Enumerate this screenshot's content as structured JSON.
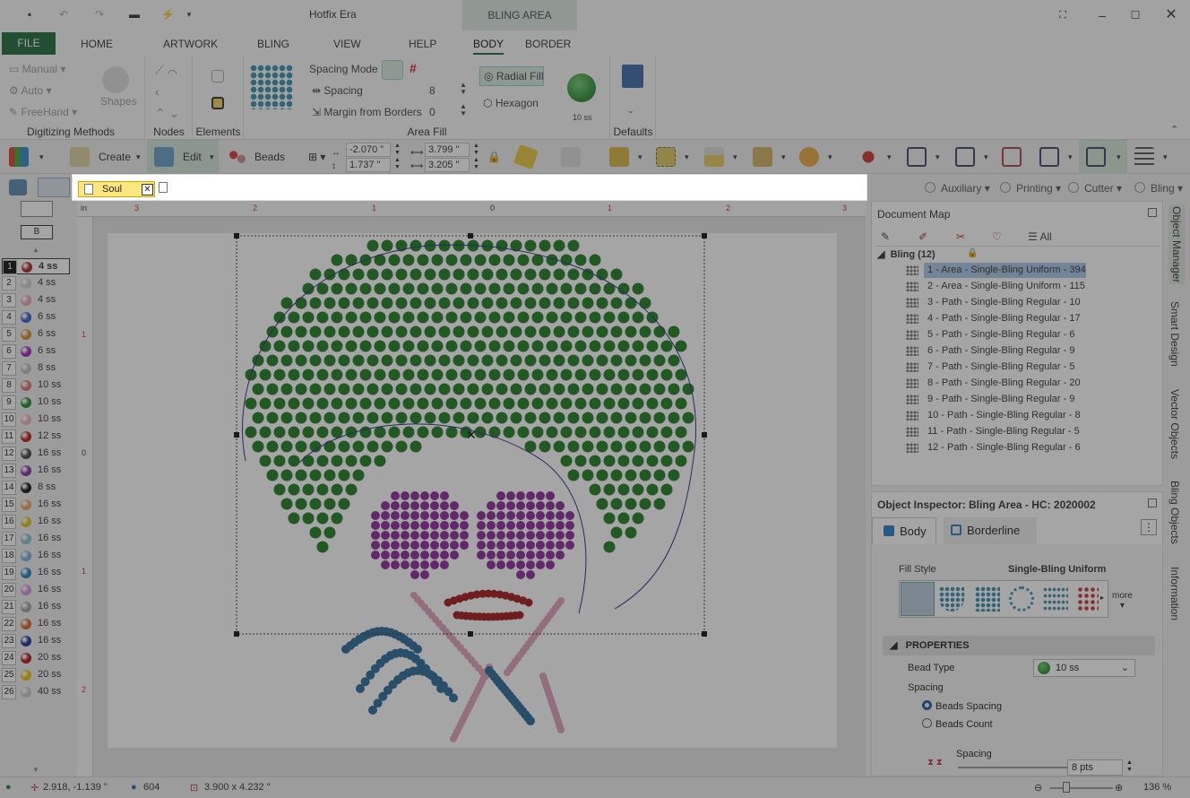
{
  "app": {
    "title": "Hotfix Era",
    "context_tab": "BLING AREA"
  },
  "ribbon_tabs": [
    "FILE",
    "HOME",
    "ARTWORK",
    "BLING",
    "VIEW",
    "HELP",
    "BODY",
    "BORDER"
  ],
  "active_tab": "BODY",
  "ribbon": {
    "digitizing": {
      "label": "Digitizing Methods",
      "manual": "Manual",
      "auto": "Auto",
      "freehand": "FreeHand"
    },
    "shapes": {
      "label": "Shapes"
    },
    "nodes": {
      "label": "Nodes"
    },
    "elements": {
      "label": "Elements"
    },
    "area_fill": {
      "label": "Area Fill",
      "spacing_mode": "Spacing Mode",
      "spacing_label": "Spacing",
      "spacing_value": "8",
      "margin_label": "Margin from Borders",
      "margin_value": "0",
      "radial_fill": "Radial Fill",
      "hexagon": "Hexagon",
      "bead_size": "10 ss",
      "hash": "#"
    },
    "defaults": {
      "label": "Defaults"
    }
  },
  "toolbar": {
    "create": "Create",
    "edit": "Edit",
    "beads": "Beads",
    "x": "-2.070 \"",
    "y": "1.737 \"",
    "w": "3.799 \"",
    "h": "3.205 \""
  },
  "doc_tab": {
    "name": "Soul"
  },
  "filters": [
    "Auxiliary",
    "Printing",
    "Cutter",
    "Bling"
  ],
  "palette": {
    "toggle_label": "B",
    "rows": [
      {
        "n": "1",
        "size": "4 ss",
        "color": "#b02020"
      },
      {
        "n": "2",
        "size": "4 ss",
        "color": "#cfcfcf"
      },
      {
        "n": "3",
        "size": "4 ss",
        "color": "#e7a0b6"
      },
      {
        "n": "4",
        "size": "6 ss",
        "color": "#2a5fd0"
      },
      {
        "n": "5",
        "size": "6 ss",
        "color": "#e08a20"
      },
      {
        "n": "6",
        "size": "6 ss",
        "color": "#a020c0"
      },
      {
        "n": "7",
        "size": "8 ss",
        "color": "#bdbdbd"
      },
      {
        "n": "8",
        "size": "10 ss",
        "color": "#e07070"
      },
      {
        "n": "9",
        "size": "10 ss",
        "color": "#1a8a2a"
      },
      {
        "n": "10",
        "size": "10 ss",
        "color": "#f0b0c0"
      },
      {
        "n": "11",
        "size": "12 ss",
        "color": "#c01818"
      },
      {
        "n": "12",
        "size": "16 ss",
        "color": "#444444"
      },
      {
        "n": "13",
        "size": "16 ss",
        "color": "#8a2aa0"
      },
      {
        "n": "14",
        "size": "8 ss",
        "color": "#111111"
      },
      {
        "n": "15",
        "size": "16 ss",
        "color": "#f0a060"
      },
      {
        "n": "16",
        "size": "16 ss",
        "color": "#e0c020"
      },
      {
        "n": "17",
        "size": "16 ss",
        "color": "#80c0d0"
      },
      {
        "n": "18",
        "size": "16 ss",
        "color": "#70b0e0"
      },
      {
        "n": "19",
        "size": "16 ss",
        "color": "#1a80c0"
      },
      {
        "n": "20",
        "size": "16 ss",
        "color": "#d090e0"
      },
      {
        "n": "21",
        "size": "16 ss",
        "color": "#a0a0a0"
      },
      {
        "n": "22",
        "size": "16 ss",
        "color": "#e06020"
      },
      {
        "n": "23",
        "size": "16 ss",
        "color": "#1a2aa0"
      },
      {
        "n": "24",
        "size": "20 ss",
        "color": "#b01010"
      },
      {
        "n": "25",
        "size": "20 ss",
        "color": "#e8c000"
      },
      {
        "n": "26",
        "size": "40 ss",
        "color": "#c8c8c8"
      }
    ]
  },
  "ruler": {
    "unit": "in",
    "h_labels": [
      "3",
      "2",
      "1",
      "0",
      "1",
      "2",
      "3"
    ],
    "v_labels": [
      "1",
      "0",
      "1",
      "2"
    ]
  },
  "doc_map": {
    "title": "Document Map",
    "all_tab": "All",
    "group": "Bling (12)",
    "items": [
      "1 - Area - Single-Bling Uniform - 394",
      "2 - Area - Single-Bling Uniform - 115",
      "3 - Path - Single-Bling Regular - 10",
      "4 - Path - Single-Bling Regular - 17",
      "5 - Path - Single-Bling Regular - 6",
      "6 - Path - Single-Bling Regular - 9",
      "7 - Path - Single-Bling Regular - 5",
      "8 - Path - Single-Bling Regular - 20",
      "9 - Path - Single-Bling Regular - 9",
      "10 - Path - Single-Bling Regular - 8",
      "11 - Path - Single-Bling Regular - 5",
      "12 - Path - Single-Bling Regular - 6"
    ]
  },
  "inspector": {
    "title": "Object Inspector: Bling Area - HC: 2020002",
    "tab_body": "Body",
    "tab_border": "Borderline",
    "fill_style_label": "Fill Style",
    "fill_style_value": "Single-Bling Uniform",
    "more": "more",
    "properties": "PROPERTIES",
    "bead_type_label": "Bead Type",
    "bead_type_value": "10 ss",
    "spacing_label": "Spacing",
    "beads_spacing": "Beads Spacing",
    "beads_count": "Beads Count",
    "spacing_sub": "Spacing",
    "spacing_value": "8 pts"
  },
  "side_tabs": [
    "Object Manager",
    "Smart Design",
    "Vector Objects",
    "Bling Objects",
    "Information"
  ],
  "status": {
    "coords": "2.918, -1.139 \"",
    "count": "604",
    "size": "3.900 x 4.232 \"",
    "zoom": "136 %"
  }
}
